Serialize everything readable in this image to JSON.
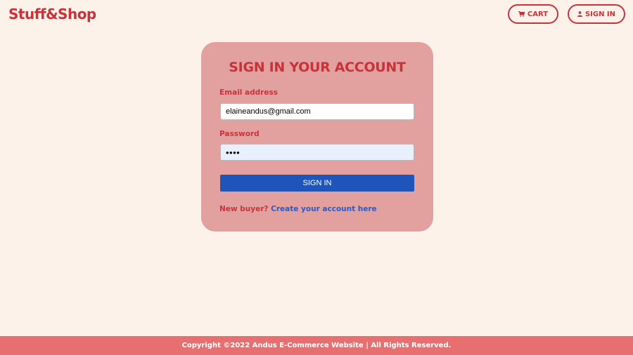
{
  "header": {
    "logo": "Stuff&Shop",
    "cart_label": "CART",
    "cart_icon": "cart-icon",
    "signin_label": "SIGN IN",
    "signin_icon": "user-icon"
  },
  "form": {
    "title": "SIGN IN YOUR ACCOUNT",
    "email_label": "Email address",
    "email_value": "elaineandus@gmail.com",
    "password_label": "Password",
    "password_value": "••••",
    "submit_label": "SIGN IN",
    "register_prefix": "New buyer?",
    "register_link": "Create your account here"
  },
  "footer": {
    "text": "Copyright ©2022 Andus E-Commerce Website | All Rights Reserved."
  },
  "colors": {
    "background": "#fcf2ea",
    "accent": "#c8333a",
    "card": "#e2a09f",
    "button": "#1f55b8",
    "footer": "#e86f6f"
  }
}
